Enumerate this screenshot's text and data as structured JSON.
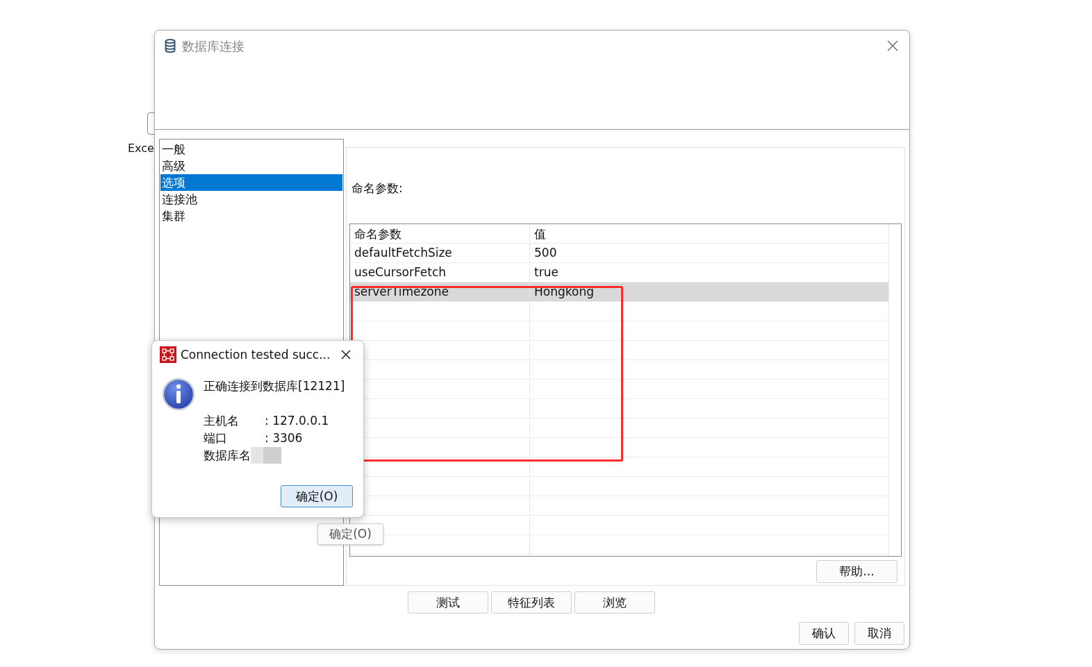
{
  "backdrop": {
    "label": "Exce",
    "button": "确定(O)"
  },
  "window": {
    "title": "数据库连接"
  },
  "nav": [
    {
      "label": "一般",
      "selected": false
    },
    {
      "label": "高级",
      "selected": false
    },
    {
      "label": "选项",
      "selected": true
    },
    {
      "label": "连接池",
      "selected": false
    },
    {
      "label": "集群",
      "selected": false
    }
  ],
  "options": {
    "heading": "命名参数:",
    "columns": [
      "命名参数",
      "值"
    ],
    "rows": [
      {
        "name": "defaultFetchSize",
        "value": "500",
        "selected": false
      },
      {
        "name": "useCursorFetch",
        "value": "true",
        "selected": false
      },
      {
        "name": "serverTimezone",
        "value": "Hongkong",
        "selected": true
      }
    ],
    "help_button": "帮助..."
  },
  "action_buttons": [
    "测试",
    "特征列表",
    "浏览"
  ],
  "footer_buttons": [
    "确认",
    "取消"
  ],
  "annotation": {
    "kind": "red_box"
  },
  "popup": {
    "title": "Connection tested succ...",
    "message": "正确连接到数据库[12121]",
    "details": [
      {
        "label": "主机名",
        "value": ": 127.0.0.1"
      },
      {
        "label": "端口",
        "value": ": 3306"
      },
      {
        "label": "数据库名"
      }
    ],
    "redacted": true,
    "ok_button": "确定(O)"
  }
}
